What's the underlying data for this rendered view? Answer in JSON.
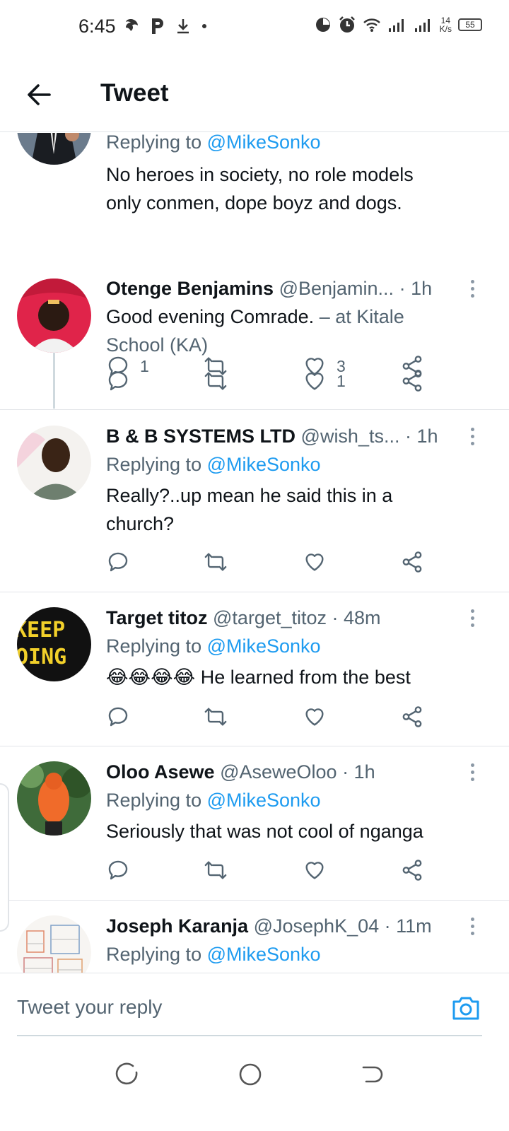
{
  "status_bar": {
    "time": "6:45",
    "net_speed_value": "14",
    "net_speed_unit": "K/s",
    "battery": "55"
  },
  "header": {
    "title": "Tweet"
  },
  "tweets": [
    {
      "replying_prefix": "Replying to ",
      "replying_handle": "@MikeSonko",
      "text_line1": "No heroes in society, no role models",
      "text_line2": "only conmen, dope boyz and dogs.",
      "replies": "1",
      "likes": "3"
    },
    {
      "name": "Otenge Benjamins",
      "handle": "@Benjamin...",
      "time": "· 1h",
      "text": "Good evening  Comrade. ",
      "location": "– at Kitale",
      "location_line2": "School (KA)",
      "likes": "1"
    },
    {
      "name": "B & B SYSTEMS LTD",
      "handle": "@wish_ts...",
      "time": "· 1h",
      "replying_prefix": "Replying to ",
      "replying_handle": "@MikeSonko",
      "text_line1": "Really?..up mean he said this in a",
      "text_line2": "church?"
    },
    {
      "name": "Target titoz",
      "handle": "@target_titoz",
      "time": "· 48m",
      "replying_prefix": "Replying to ",
      "replying_handle": "@MikeSonko",
      "emojis": "😂😂😂😂",
      "text": " He learned from the best",
      "avatar_text_top": "KEEP",
      "avatar_text_bottom": "OING"
    },
    {
      "name": "Oloo Asewe",
      "handle": "@AseweOloo",
      "time": "· 1h",
      "replying_prefix": "Replying to ",
      "replying_handle": "@MikeSonko",
      "text": "Seriously that was not cool of nganga"
    },
    {
      "name": "Joseph Karanja",
      "handle": "@JosephK_04",
      "time": "· 11m",
      "replying_prefix": "Replying to ",
      "replying_handle": "@MikeSonko"
    }
  ],
  "reply_bar": {
    "placeholder": "Tweet your reply"
  },
  "colors": {
    "accent": "#1d9bf0",
    "secondary_text": "#536471",
    "primary_text": "#0f1419",
    "divider": "#e1e4e8"
  }
}
